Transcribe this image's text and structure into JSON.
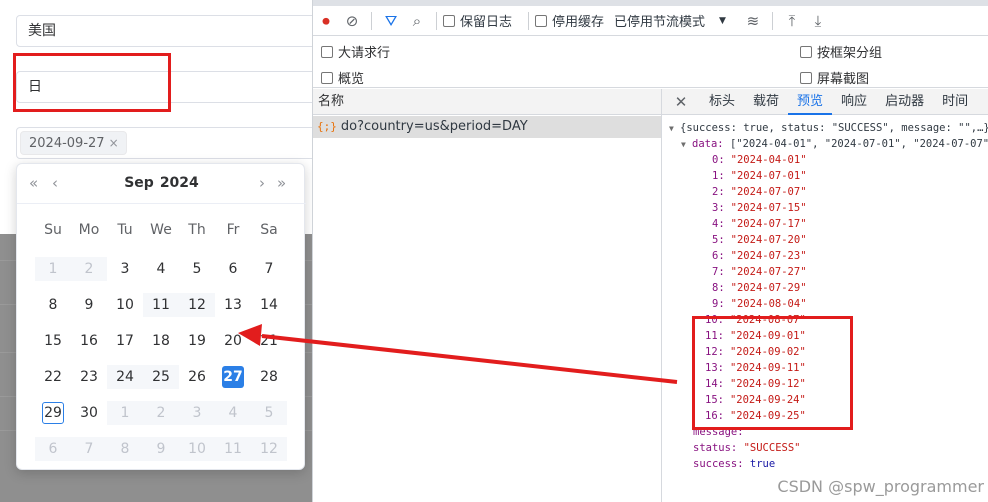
{
  "form": {
    "country_value": "美国",
    "period_value": "日",
    "selected_date_tag": "2024-09-27",
    "tag_close_icon": "×"
  },
  "picker": {
    "month": "Sep",
    "year": "2024",
    "prev_year_icon": "«",
    "prev_month_icon": "‹",
    "next_month_icon": "›",
    "next_year_icon": "»",
    "weekdays": [
      "Su",
      "Mo",
      "Tu",
      "We",
      "Th",
      "Fr",
      "Sa"
    ],
    "days": [
      {
        "d": "1",
        "s": "prev"
      },
      {
        "d": "2",
        "s": "prev"
      },
      {
        "d": "3",
        "s": "cur"
      },
      {
        "d": "4",
        "s": "cur"
      },
      {
        "d": "5",
        "s": "cur"
      },
      {
        "d": "6",
        "s": "cur"
      },
      {
        "d": "7",
        "s": "cur"
      },
      {
        "d": "8",
        "s": "cur"
      },
      {
        "d": "9",
        "s": "cur"
      },
      {
        "d": "10",
        "s": "cur"
      },
      {
        "d": "11",
        "s": "dis"
      },
      {
        "d": "12",
        "s": "dis"
      },
      {
        "d": "13",
        "s": "cur"
      },
      {
        "d": "14",
        "s": "cur"
      },
      {
        "d": "15",
        "s": "cur"
      },
      {
        "d": "16",
        "s": "cur"
      },
      {
        "d": "17",
        "s": "cur"
      },
      {
        "d": "18",
        "s": "cur"
      },
      {
        "d": "19",
        "s": "cur"
      },
      {
        "d": "20",
        "s": "cur"
      },
      {
        "d": "21",
        "s": "cur"
      },
      {
        "d": "22",
        "s": "cur"
      },
      {
        "d": "23",
        "s": "cur"
      },
      {
        "d": "24",
        "s": "dis"
      },
      {
        "d": "25",
        "s": "dis"
      },
      {
        "d": "26",
        "s": "cur"
      },
      {
        "d": "27",
        "s": "sel"
      },
      {
        "d": "28",
        "s": "cur"
      },
      {
        "d": "29",
        "s": "today"
      },
      {
        "d": "30",
        "s": "cur"
      },
      {
        "d": "1",
        "s": "next"
      },
      {
        "d": "2",
        "s": "next"
      },
      {
        "d": "3",
        "s": "next"
      },
      {
        "d": "4",
        "s": "next"
      },
      {
        "d": "5",
        "s": "next"
      },
      {
        "d": "6",
        "s": "next"
      },
      {
        "d": "7",
        "s": "next"
      },
      {
        "d": "8",
        "s": "next"
      },
      {
        "d": "9",
        "s": "next"
      },
      {
        "d": "10",
        "s": "next"
      },
      {
        "d": "11",
        "s": "next"
      },
      {
        "d": "12",
        "s": "next"
      }
    ]
  },
  "devtools": {
    "toolbar": {
      "record_icon": "⏺",
      "clear_icon": "⊘",
      "filter_icon": "⛛",
      "search_icon": "⌕",
      "preserve_log": "保留日志",
      "disable_cache": "停用缓存",
      "throttle": "已停用节流模式",
      "throttle_arrow": "▼",
      "wifi_icon": "≋",
      "upload_icon": "⤒",
      "download_icon": "⤓"
    },
    "options": {
      "large_rows": "大请求行",
      "group_by_frame": "按框架分组",
      "overview": "概览",
      "screenshots": "屏幕截图"
    },
    "name_header": "名称",
    "request_icon": "{;}",
    "request_name": "do?country=us&period=DAY",
    "close_icon": "✕",
    "tabs": [
      "标头",
      "载荷",
      "预览",
      "响应",
      "启动器",
      "时间"
    ],
    "active_tab": "预览",
    "preview": {
      "root_line": "{success: true, status: \"SUCCESS\", message: \"\",…}",
      "data_key": "data:",
      "data_summary": "[\"2024-04-01\", \"2024-07-01\", \"2024-07-07\",",
      "items": [
        {
          "i": "0:",
          "v": "\"2024-04-01\""
        },
        {
          "i": "1:",
          "v": "\"2024-07-01\""
        },
        {
          "i": "2:",
          "v": "\"2024-07-07\""
        },
        {
          "i": "3:",
          "v": "\"2024-07-15\""
        },
        {
          "i": "4:",
          "v": "\"2024-07-17\""
        },
        {
          "i": "5:",
          "v": "\"2024-07-20\""
        },
        {
          "i": "6:",
          "v": "\"2024-07-23\""
        },
        {
          "i": "7:",
          "v": "\"2024-07-27\""
        },
        {
          "i": "8:",
          "v": "\"2024-07-29\""
        },
        {
          "i": "9:",
          "v": "\"2024-08-04\""
        },
        {
          "i": "10:",
          "v": "\"2024-08-07\""
        },
        {
          "i": "11:",
          "v": "\"2024-09-01\""
        },
        {
          "i": "12:",
          "v": "\"2024-09-02\""
        },
        {
          "i": "13:",
          "v": "\"2024-09-11\""
        },
        {
          "i": "14:",
          "v": "\"2024-09-12\""
        },
        {
          "i": "15:",
          "v": "\"2024-09-24\""
        },
        {
          "i": "16:",
          "v": "\"2024-09-25\""
        }
      ],
      "message_key": "message:",
      "message_val": "\"\"",
      "status_key": "status:",
      "status_val": "\"SUCCESS\"",
      "success_key": "success:",
      "success_val": "true"
    }
  },
  "watermark": "CSDN @spw_programmer",
  "colors": {
    "annotation_red": "#e21d1d",
    "selected_blue": "#2b7fe6",
    "active_tab_blue": "#1a73e8"
  }
}
